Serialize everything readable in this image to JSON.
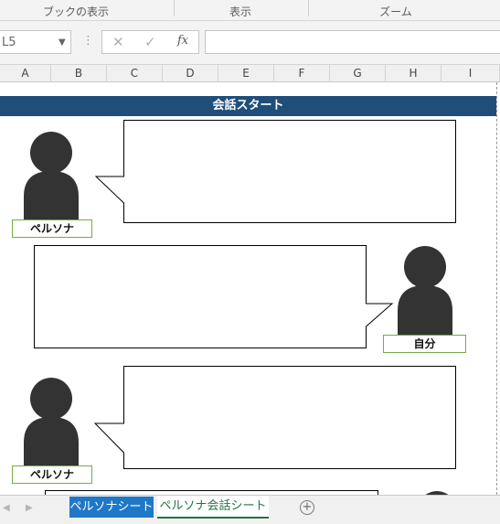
{
  "ribbon": {
    "groups": [
      {
        "label": "ブックの表示"
      },
      {
        "label": "表示"
      },
      {
        "label": "ズーム"
      }
    ]
  },
  "formula_bar": {
    "name_box": "L5",
    "cancel_icon": "✕",
    "enter_icon": "✓",
    "fx_label": "fx",
    "value": ""
  },
  "columns": [
    "A",
    "B",
    "C",
    "D",
    "E",
    "F",
    "G",
    "H",
    "I"
  ],
  "sheet": {
    "banner": "会話スタート",
    "rows": [
      {
        "speaker": "ペルソナ",
        "text": ""
      },
      {
        "speaker": "自分",
        "text": ""
      },
      {
        "speaker": "ペルソナ",
        "text": ""
      }
    ]
  },
  "tabs": [
    {
      "label": "ペルソナシート",
      "active": false
    },
    {
      "label": "ペルソナ会話シート",
      "active": true
    }
  ],
  "colors": {
    "banner": "#1f4e79",
    "avatar": "#333333",
    "label_border": "#70ad47",
    "tab_blue": "#1f77c7",
    "excel_green": "#217346"
  },
  "icons": [
    "dropdown-arrow-icon",
    "cancel-icon",
    "enter-icon",
    "function-icon",
    "person-icon",
    "add-sheet-icon",
    "scroll-left-icon",
    "scroll-right-icon"
  ]
}
